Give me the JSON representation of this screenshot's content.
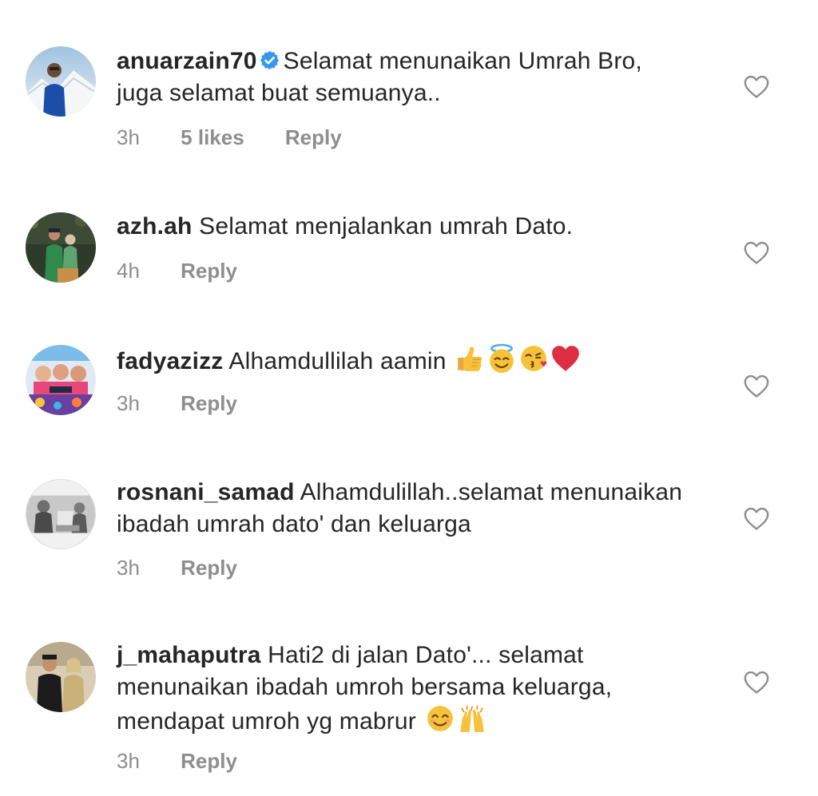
{
  "comments": [
    {
      "username": "anuarzain70",
      "verified": true,
      "text": "Selamat menunaikan Umrah Bro, juga selamat buat semuanya..",
      "time": "3h",
      "likes": "5 likes",
      "reply": "Reply"
    },
    {
      "username": "azh.ah",
      "verified": false,
      "text": "Selamat menjalankan umrah Dato.",
      "time": "4h",
      "reply": "Reply"
    },
    {
      "username": "fadyazizz",
      "verified": false,
      "text": "Alhamdullilah aamin",
      "emojis": [
        "thumbs-up",
        "smiling-face-with-halo",
        "face-blowing-a-kiss",
        "red-heart"
      ],
      "time": "3h",
      "reply": "Reply"
    },
    {
      "username": "rosnani_samad",
      "verified": false,
      "text": "Alhamdulillah..selamat menunaikan ibadah umrah dato' dan keluarga",
      "time": "3h",
      "reply": "Reply"
    },
    {
      "username": "j_mahaputra",
      "verified": false,
      "text": "Hati2 di jalan Dato'... selamat menunaikan ibadah umroh bersama keluarga, mendapat umroh yg mabrur",
      "emojis": [
        "smiling-face-with-smiling-eyes",
        "raising-hands"
      ],
      "time": "3h",
      "reply": "Reply"
    }
  ],
  "icons": {
    "like": "heart-outline-icon",
    "verified": "verified-badge-icon"
  },
  "colors": {
    "text": "#262626",
    "meta": "#8e8e8e",
    "verified": "#3897f0",
    "heart_outline": "#8e8e8e"
  }
}
